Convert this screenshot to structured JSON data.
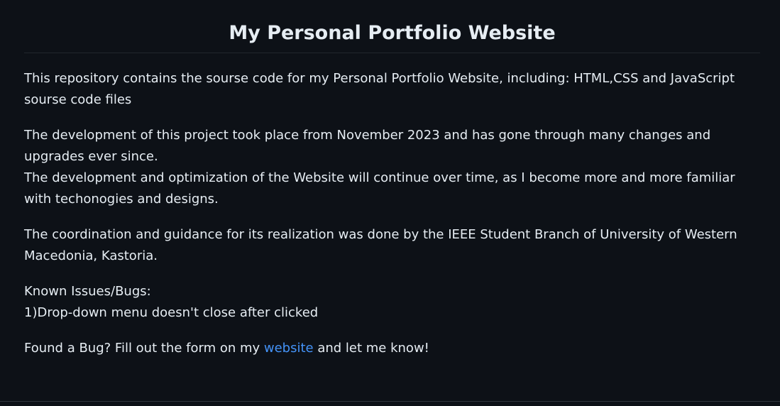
{
  "readme": {
    "title": "My Personal Portfolio Website",
    "intro": "This repository contains the sourse code for my Personal Portfolio Website, including: HTML,CSS and JavaScript sourse code files",
    "development_line1": "The development of this project took place from November 2023 and has gone through many changes and upgrades ever since.",
    "development_line2": "The development and optimization of the Website will continue over time, as I become more and more familiar with techonogies and designs.",
    "coordination": "The coordination and guidance for its realization was done by the IEEE Student Branch of University of Western Macedonia, Kastoria.",
    "known_issues_heading": "Known Issues/Bugs:",
    "known_issue_1": "1)Drop-down menu doesn't close after clicked",
    "bug_prefix": "Found a Bug? Fill out the form on my ",
    "bug_link": "website",
    "bug_suffix": " and let me know!"
  },
  "colors": {
    "background": "#0d1117",
    "text": "#e6edf3",
    "link": "#4493f8",
    "divider": "#21262d"
  }
}
